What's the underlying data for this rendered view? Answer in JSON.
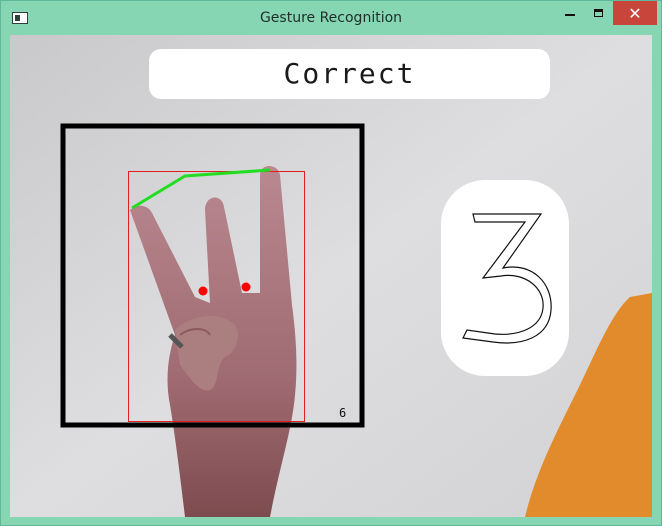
{
  "window": {
    "title": "Gesture Recognition",
    "close_glyph": "✕"
  },
  "icons": [
    "app-icon",
    "minimize-icon",
    "maximize-icon",
    "close-icon"
  ],
  "overlay": {
    "status_text": "Correct",
    "predicted_digit": "3",
    "count_label": "6"
  },
  "colors": {
    "titlebar": "#86d6b4",
    "close_button": "#c7453b",
    "roi_box": "#000000",
    "hand_box": "#e02020",
    "finger_line": "#22dd22",
    "defect_points": "#ff0000"
  }
}
